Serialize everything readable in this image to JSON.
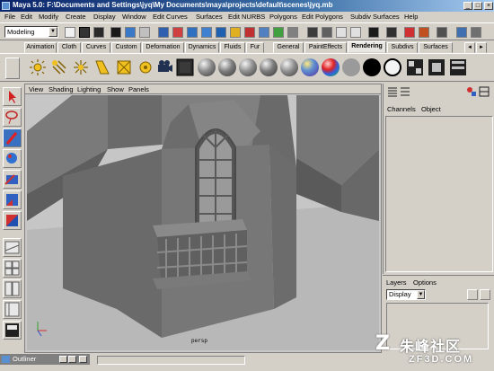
{
  "window": {
    "title": "Maya 5.0: F:\\Documents and Settings\\jyq\\My Documents\\maya\\projects\\default\\scenes\\jyq.mb",
    "minimize": "_",
    "maximize": "□",
    "close": "×"
  },
  "menubar": [
    "File",
    "Edit",
    "Modify",
    "Create",
    "Display",
    "Window",
    "Edit Curves",
    "Surfaces",
    "Edit NURBS",
    "Polygons",
    "Edit Polygons",
    "Subdiv Surfaces",
    "Help"
  ],
  "statusline": {
    "mode": "Modeling"
  },
  "shelf": {
    "tabs": [
      "Animation",
      "Cloth",
      "Curves",
      "Custom",
      "Deformation",
      "Dynamics",
      "Fluids",
      "Fur",
      "General",
      "PaintEffects",
      "Rendering",
      "Subdivs",
      "Surfaces"
    ],
    "active_tab": "Rendering",
    "sphere_colors": [
      "#8a8a8a",
      "#7c7c7c",
      "#8e8e8e",
      "#7a7a7a",
      "#909090"
    ]
  },
  "viewport": {
    "menus": [
      "View",
      "Shading",
      "Lighting",
      "Show",
      "Panels"
    ],
    "camera": "persp"
  },
  "channel_box": {
    "menus": [
      "Channels",
      "Object"
    ]
  },
  "layer_editor": {
    "menus": [
      "Layers",
      "Options"
    ],
    "display": "Display"
  },
  "outliner": {
    "title": "Outliner"
  },
  "watermark": {
    "logo": "Z",
    "name": "朱峰社区",
    "url": "ZF3D.COM"
  }
}
